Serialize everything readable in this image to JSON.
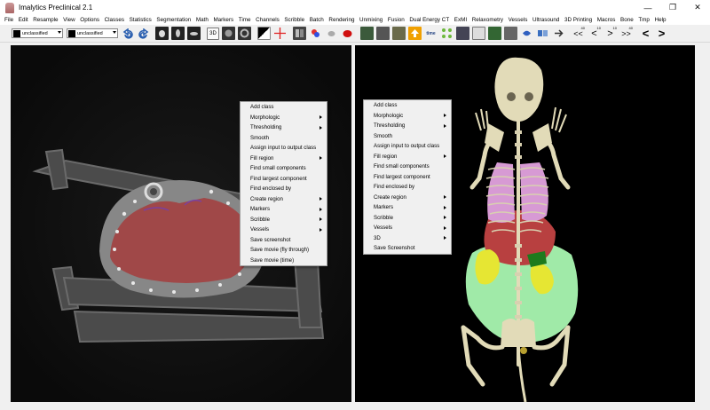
{
  "window": {
    "title": "Imalytics Preclinical 2.1",
    "minimize": "—",
    "restore": "❐",
    "close": "✕"
  },
  "menu": [
    "File",
    "Edit",
    "Resample",
    "View",
    "Options",
    "Classes",
    "Statistics",
    "Segmentation",
    "Math",
    "Markers",
    "Time",
    "Channels",
    "Scribble",
    "Batch",
    "Rendering",
    "Unmixing",
    "Fusion",
    "Dual Energy CT",
    "ExMI",
    "Relaxometry",
    "Vessels",
    "Ultrasound",
    "3D Printing",
    "Macros",
    "Bone",
    "Tmp",
    "Help"
  ],
  "toolbar": {
    "input_class": "unclassified",
    "output_class": "unclassified",
    "btn_3d": "3D",
    "nav_labels": [
      "<<",
      "<",
      ">",
      ">>"
    ],
    "nav_superscripts": [
      "40",
      "10",
      "10",
      "40"
    ]
  },
  "left_menu": {
    "items": [
      {
        "label": "Add class",
        "sub": false
      },
      {
        "label": "Morphologic",
        "sub": true
      },
      {
        "label": "Thresholding",
        "sub": true
      },
      {
        "label": "Smooth",
        "sub": false
      },
      {
        "label": "Assign input to output class",
        "sub": false
      },
      {
        "label": "Fill region",
        "sub": true
      },
      {
        "label": "Find small components",
        "sub": false
      },
      {
        "label": "Find largest component",
        "sub": false
      },
      {
        "label": "Find enclosed by",
        "sub": false
      },
      {
        "label": "Create region",
        "sub": true
      },
      {
        "label": "Markers",
        "sub": true
      },
      {
        "label": "Scribble",
        "sub": true
      },
      {
        "label": "Vessels",
        "sub": true
      },
      {
        "label": "Save screenshot",
        "sub": false
      },
      {
        "label": "Save movie (fly through)",
        "sub": false
      },
      {
        "label": "Save movie (time)",
        "sub": false
      }
    ]
  },
  "right_menu": {
    "items": [
      {
        "label": "Add class",
        "sub": false
      },
      {
        "label": "Morphologic",
        "sub": true
      },
      {
        "label": "Thresholding",
        "sub": true
      },
      {
        "label": "Smooth",
        "sub": false
      },
      {
        "label": "Assign input to output class",
        "sub": false
      },
      {
        "label": "Fill region",
        "sub": true
      },
      {
        "label": "Find small components",
        "sub": false
      },
      {
        "label": "Find largest component",
        "sub": false
      },
      {
        "label": "Find enclosed by",
        "sub": false
      },
      {
        "label": "Create region",
        "sub": true
      },
      {
        "label": "Markers",
        "sub": true
      },
      {
        "label": "Scribble",
        "sub": true
      },
      {
        "label": "Vessels",
        "sub": true
      },
      {
        "label": "3D",
        "sub": true
      },
      {
        "label": "Save Screenshot",
        "sub": false
      }
    ]
  },
  "colors": {
    "viewport_bg": "#000000",
    "segmentation_red": "#a04848",
    "segmentation_purple": "#7a40a0",
    "bone": "#e2dbb8",
    "lung": "#d79ad4",
    "liver": "#b84040",
    "kidney": "#e6e633",
    "gut": "#a0eaa8",
    "spleen": "#1d7a1d"
  }
}
